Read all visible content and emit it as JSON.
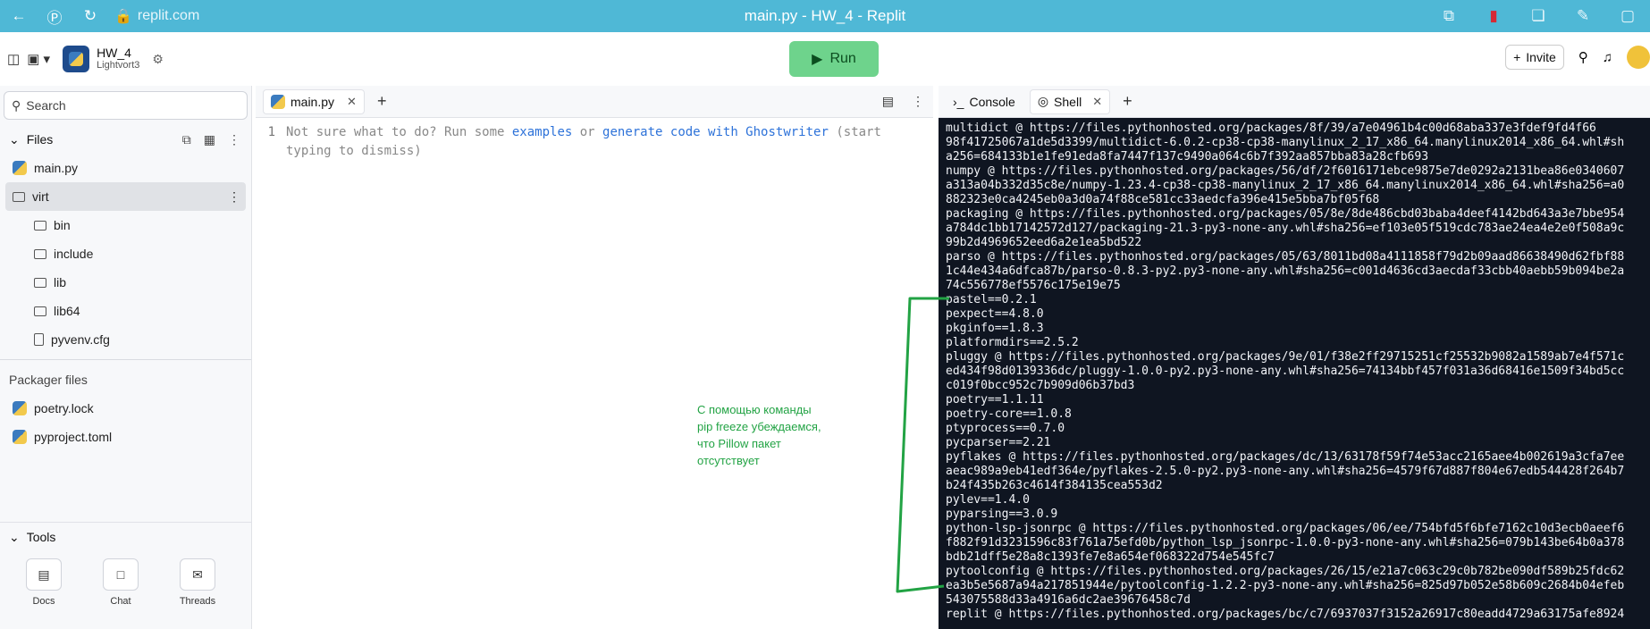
{
  "browser": {
    "url": "replit.com",
    "title": "main.py - HW_4 - Replit"
  },
  "header": {
    "repl_name": "HW_4",
    "user": "Lightvort3",
    "run_label": "Run",
    "invite_label": "Invite"
  },
  "sidebar": {
    "search_placeholder": "Search",
    "files_title": "Files",
    "files": [
      {
        "name": "main.py"
      },
      {
        "name": "virt"
      },
      {
        "name": "bin"
      },
      {
        "name": "include"
      },
      {
        "name": "lib"
      },
      {
        "name": "lib64"
      },
      {
        "name": "pyvenv.cfg"
      }
    ],
    "packager_title": "Packager files",
    "packager_files": [
      {
        "name": "poetry.lock"
      },
      {
        "name": "pyproject.toml"
      }
    ],
    "tools_title": "Tools",
    "tools": [
      {
        "label": "Docs",
        "icon": "docs-icon"
      },
      {
        "label": "Chat",
        "icon": "chat-icon"
      },
      {
        "label": "Threads",
        "icon": "threads-icon"
      }
    ]
  },
  "editor": {
    "tab_label": "main.py",
    "line_number": "1",
    "hint_prefix": "Not sure what to do? Run some ",
    "hint_link1": "examples",
    "hint_middle": " or ",
    "hint_link2": "generate code with Ghostwriter",
    "hint_suffix_1": " (start",
    "hint_suffix_2": "typing to dismiss)"
  },
  "annotation": {
    "line1": "С помощью команды",
    "line2": "pip freeze убеждаемся,",
    "line3": "что Pillow пакет",
    "line4": "отсутствует"
  },
  "panel": {
    "console_tab": "Console",
    "shell_tab": "Shell",
    "lines": [
      "multidict @ https://files.pythonhosted.org/packages/8f/39/a7e04961b4c00d68aba337e3fdef9fd4f66",
      "98f41725067a1de5d3399/multidict-6.0.2-cp38-cp38-manylinux_2_17_x86_64.manylinux2014_x86_64.whl#sh",
      "a256=684133b1e1fe91eda8fa7447f137c9490a064c6b7f392aa857bba83a28cfb693",
      "numpy @ https://files.pythonhosted.org/packages/56/df/2f6016171ebce9875e7de0292a2131bea86e0340607",
      "a313a04b332d35c8e/numpy-1.23.4-cp38-cp38-manylinux_2_17_x86_64.manylinux2014_x86_64.whl#sha256=a0",
      "882323e0ca4245eb0a3d0a74f88ce581cc33aedcfa396e415e5bba7bf05f68",
      "packaging @ https://files.pythonhosted.org/packages/05/8e/8de486cbd03baba4deef4142bd643a3e7bbe954",
      "a784dc1bb17142572d127/packaging-21.3-py3-none-any.whl#sha256=ef103e05f519cdc783ae24ea4e2e0f508a9c",
      "99b2d4969652eed6a2e1ea5bd522",
      "parso @ https://files.pythonhosted.org/packages/05/63/8011bd08a4111858f79d2b09aad86638490d62fbf88",
      "1c44e434a6dfca87b/parso-0.8.3-py2.py3-none-any.whl#sha256=c001d4636cd3aecdaf33cbb40aebb59b094be2a",
      "74c556778ef5576c175e19e75",
      "pastel==0.2.1",
      "pexpect==4.8.0",
      "pkginfo==1.8.3",
      "platformdirs==2.5.2",
      "pluggy @ https://files.pythonhosted.org/packages/9e/01/f38e2ff29715251cf25532b9082a1589ab7e4f571c",
      "ed434f98d0139336dc/pluggy-1.0.0-py2.py3-none-any.whl#sha256=74134bbf457f031a36d68416e1509f34bd5cc",
      "c019f0bcc952c7b909d06b37bd3",
      "poetry==1.1.11",
      "poetry-core==1.0.8",
      "ptyprocess==0.7.0",
      "pycparser==2.21",
      "pyflakes @ https://files.pythonhosted.org/packages/dc/13/63178f59f74e53acc2165aee4b002619a3cfa7ee",
      "aeac989a9eb41edf364e/pyflakes-2.5.0-py2.py3-none-any.whl#sha256=4579f67d887f804e67edb544428f264b7",
      "b24f435b263c4614f384135cea553d2",
      "pylev==1.4.0",
      "pyparsing==3.0.9",
      "python-lsp-jsonrpc @ https://files.pythonhosted.org/packages/06/ee/754bfd5f6bfe7162c10d3ecb0aeef6",
      "f882f91d3231596c83f761a75efd0b/python_lsp_jsonrpc-1.0.0-py3-none-any.whl#sha256=079b143be64b0a378",
      "bdb21dff5e28a8c1393fe7e8a654ef068322d754e545fc7",
      "pytoolconfig @ https://files.pythonhosted.org/packages/26/15/e21a7c063c29c0b782be090df589b25fdc62",
      "ea3b5e5687a94a217851944e/pytoolconfig-1.2.2-py3-none-any.whl#sha256=825d97b052e58b609c2684b04efeb",
      "543075588d33a4916a6dc2ae39676458c7d",
      "replit @ https://files.pythonhosted.org/packages/bc/c7/6937037f3152a26917c80eadd4729a63175afe8924"
    ]
  },
  "colors": {
    "browser_bar": "#4fb8d6",
    "run_button": "#6ed38c",
    "terminal_bg": "#0f1521",
    "link": "#2d72d9",
    "annotation": "#22a344"
  }
}
